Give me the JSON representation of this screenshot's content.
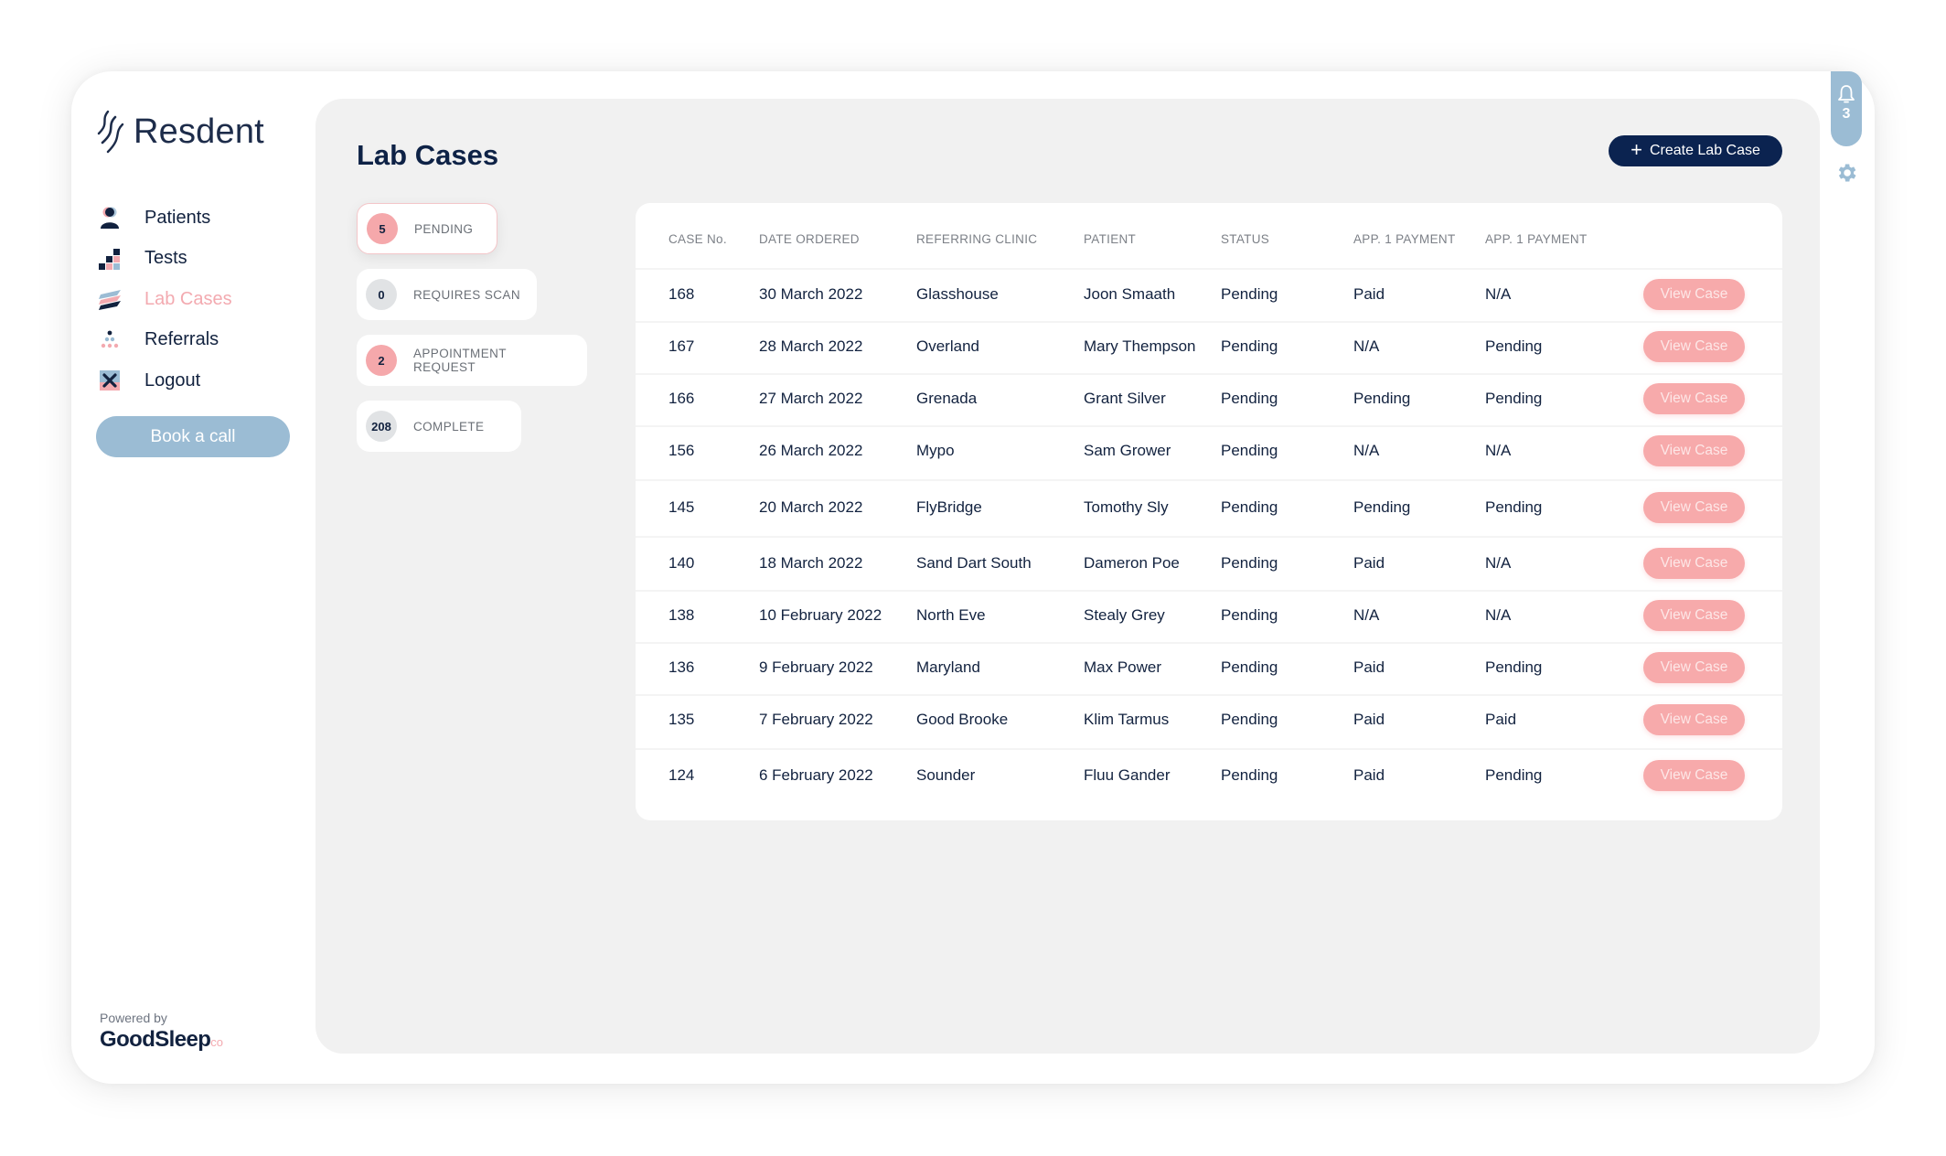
{
  "brand": {
    "name": "Resdent"
  },
  "sidebar": {
    "items": [
      {
        "label": "Patients",
        "icon": "patients-icon",
        "active": false
      },
      {
        "label": "Tests",
        "icon": "tests-icon",
        "active": false
      },
      {
        "label": "Lab Cases",
        "icon": "lab-cases-icon",
        "active": true
      },
      {
        "label": "Referrals",
        "icon": "referrals-icon",
        "active": false
      },
      {
        "label": "Logout",
        "icon": "logout-icon",
        "active": false
      }
    ],
    "book_call_label": "Book a call",
    "powered_by": "Powered by",
    "partner_name": "GoodSleep",
    "partner_suffix": "co"
  },
  "header": {
    "title": "Lab Cases",
    "create_button_label": "Create Lab Case",
    "create_button_icon": "plus-icon"
  },
  "notifications": {
    "icon": "bell-icon",
    "count": "3"
  },
  "settings": {
    "icon": "gear-icon"
  },
  "filters": [
    {
      "count": "5",
      "label": "PENDING",
      "active": true,
      "badge": "pink"
    },
    {
      "count": "0",
      "label": "REQUIRES SCAN",
      "active": false,
      "badge": "grey"
    },
    {
      "count": "2",
      "label": "APPOINTMENT REQUEST",
      "active": false,
      "badge": "pink"
    },
    {
      "count": "208",
      "label": "COMPLETE",
      "active": false,
      "badge": "grey"
    }
  ],
  "table": {
    "columns": [
      "CASE No.",
      "DATE ORDERED",
      "REFERRING CLINIC",
      "PATIENT",
      "STATUS",
      "APP. 1 PAYMENT",
      "APP. 1 PAYMENT"
    ],
    "action_label": "View Case",
    "rows": [
      {
        "case_no": "168",
        "date": "30 March 2022",
        "clinic": "Glasshouse",
        "patient": "Joon Smaath",
        "status": "Pending",
        "pay1": "Paid",
        "pay2": "N/A"
      },
      {
        "case_no": "167",
        "date": "28 March 2022",
        "clinic": "Overland",
        "patient": "Mary Thempson",
        "status": "Pending",
        "pay1": "N/A",
        "pay2": "Pending"
      },
      {
        "case_no": "166",
        "date": "27 March 2022",
        "clinic": "Grenada",
        "patient": "Grant Silver",
        "status": "Pending",
        "pay1": "Pending",
        "pay2": "Pending"
      },
      {
        "case_no": "156",
        "date": "26 March 2022",
        "clinic": "Mypo",
        "patient": "Sam Grower",
        "status": "Pending",
        "pay1": "N/A",
        "pay2": "N/A"
      },
      {
        "case_no": "145",
        "date": "20 March 2022",
        "clinic": "FlyBridge",
        "patient": "Tomothy Sly",
        "status": "Pending",
        "pay1": "Pending",
        "pay2": "Pending"
      },
      {
        "case_no": "140",
        "date": "18 March 2022",
        "clinic": "Sand Dart South",
        "patient": "Dameron Poe",
        "status": "Pending",
        "pay1": "Paid",
        "pay2": "N/A"
      },
      {
        "case_no": "138",
        "date": "10 February 2022",
        "clinic": "North Eve",
        "patient": "Stealy Grey",
        "status": "Pending",
        "pay1": "N/A",
        "pay2": "N/A"
      },
      {
        "case_no": "136",
        "date": "9 February 2022",
        "clinic": "Maryland",
        "patient": "Max Power",
        "status": "Pending",
        "pay1": "Paid",
        "pay2": "Pending"
      },
      {
        "case_no": "135",
        "date": "7 February 2022",
        "clinic": "Good Brooke",
        "patient": "Klim Tarmus",
        "status": "Pending",
        "pay1": "Paid",
        "pay2": "Paid"
      },
      {
        "case_no": "124",
        "date": "6 February 2022",
        "clinic": "Sounder",
        "patient": "Fluu Gander",
        "status": "Pending",
        "pay1": "Paid",
        "pay2": "Pending"
      }
    ]
  },
  "colors": {
    "navy": "#0e2246",
    "pink_accent": "#f7aaab",
    "blue_accent": "#9bbcd4",
    "panel_grey": "#f1f1f1"
  }
}
